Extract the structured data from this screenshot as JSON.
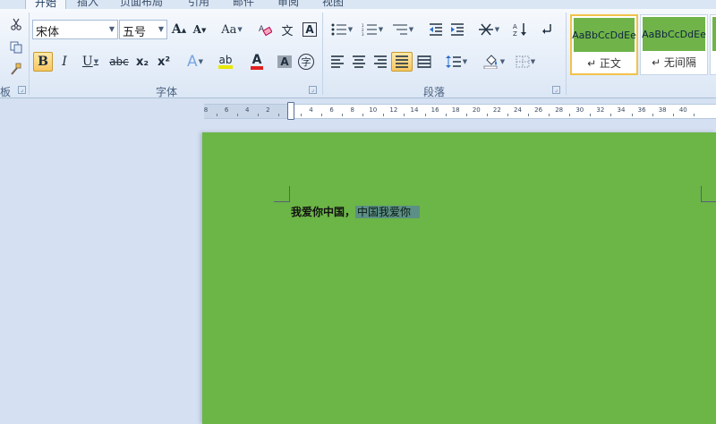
{
  "tabs": [
    "开始",
    "插入",
    "页面布局",
    "引用",
    "邮件",
    "审阅",
    "视图"
  ],
  "font_group": {
    "font_name": "宋体",
    "font_size": "五号",
    "label": "字体"
  },
  "clipboard_group": {
    "label_fragment": "板"
  },
  "paragraph_group": {
    "label": "段落"
  },
  "font_buttons": {
    "grow": "A",
    "shrink": "A",
    "change_case": "Aa",
    "phonetic": "文",
    "border_char": "A",
    "bold": "B",
    "italic": "I",
    "underline": "U",
    "strikethrough": "abc",
    "subscript": "x₂",
    "superscript": "x²",
    "text_effect": "A",
    "highlight": "ab",
    "font_color": "A",
    "shading": "A",
    "enclose": "字"
  },
  "styles": [
    {
      "preview": "AaBbCcDdEe",
      "name": "↵ 正文"
    },
    {
      "preview": "AaBbCcDdEe",
      "name": "↵ 无间隔"
    }
  ],
  "ruler_labels": [
    "8",
    "6",
    "4",
    "2",
    "2",
    "4",
    "6",
    "8",
    "10",
    "12",
    "14",
    "16",
    "18",
    "20",
    "22",
    "24",
    "26",
    "28",
    "30",
    "32",
    "34",
    "36",
    "38",
    "40"
  ],
  "document": {
    "text_plain": "我爱你中国，",
    "text_selected": "中国我爱你"
  },
  "colors": {
    "page_bg": "#6cb547",
    "active_button": "#f8c660",
    "highlight_bar": "#e8e800",
    "font_color_bar": "#e02020"
  }
}
